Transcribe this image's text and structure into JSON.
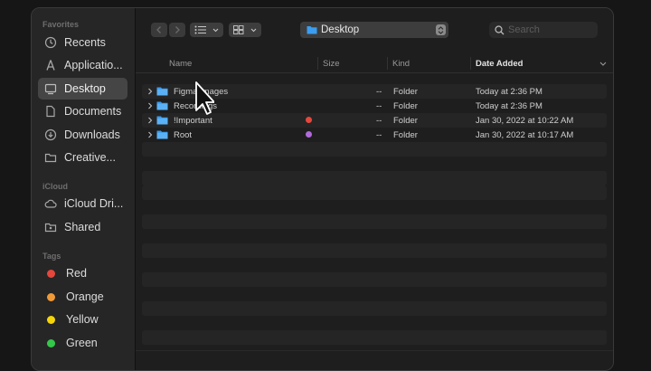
{
  "sidebar": {
    "favorites_title": "Favorites",
    "favorites": [
      {
        "label": "Recents",
        "icon": "clock-icon"
      },
      {
        "label": "Applicatio...",
        "icon": "applications-icon"
      },
      {
        "label": "Desktop",
        "icon": "desktop-icon",
        "selected": true
      },
      {
        "label": "Documents",
        "icon": "document-icon"
      },
      {
        "label": "Downloads",
        "icon": "download-icon"
      },
      {
        "label": "Creative...",
        "icon": "folder-icon"
      }
    ],
    "icloud_title": "iCloud",
    "icloud": [
      {
        "label": "iCloud Dri...",
        "icon": "cloud-icon"
      },
      {
        "label": "Shared",
        "icon": "shared-folder-icon"
      }
    ],
    "tags_title": "Tags",
    "tags": [
      {
        "label": "Red",
        "color": "#e5473d"
      },
      {
        "label": "Orange",
        "color": "#f09a37"
      },
      {
        "label": "Yellow",
        "color": "#f5d40a"
      },
      {
        "label": "Green",
        "color": "#34c84a"
      }
    ]
  },
  "toolbar": {
    "location": "Desktop",
    "search_placeholder": "Search"
  },
  "columns": {
    "name": "Name",
    "size": "Size",
    "kind": "Kind",
    "date_added": "Date Added"
  },
  "files": [
    {
      "name": "Figma Images",
      "size": "--",
      "kind": "Folder",
      "date_added": "Today at 2:36 PM",
      "tag_color": ""
    },
    {
      "name": "Recordings",
      "size": "--",
      "kind": "Folder",
      "date_added": "Today at 2:36 PM",
      "tag_color": ""
    },
    {
      "name": "!Important",
      "size": "--",
      "kind": "Folder",
      "date_added": "Jan 30, 2022 at 10:22 AM",
      "tag_color": "#e5473d"
    },
    {
      "name": "Root",
      "size": "--",
      "kind": "Folder",
      "date_added": "Jan 30, 2022 at 10:17 AM",
      "tag_color": "#b06ad9"
    }
  ],
  "colors": {
    "accent_folder": "#3a9df0",
    "selection": "#454545"
  }
}
